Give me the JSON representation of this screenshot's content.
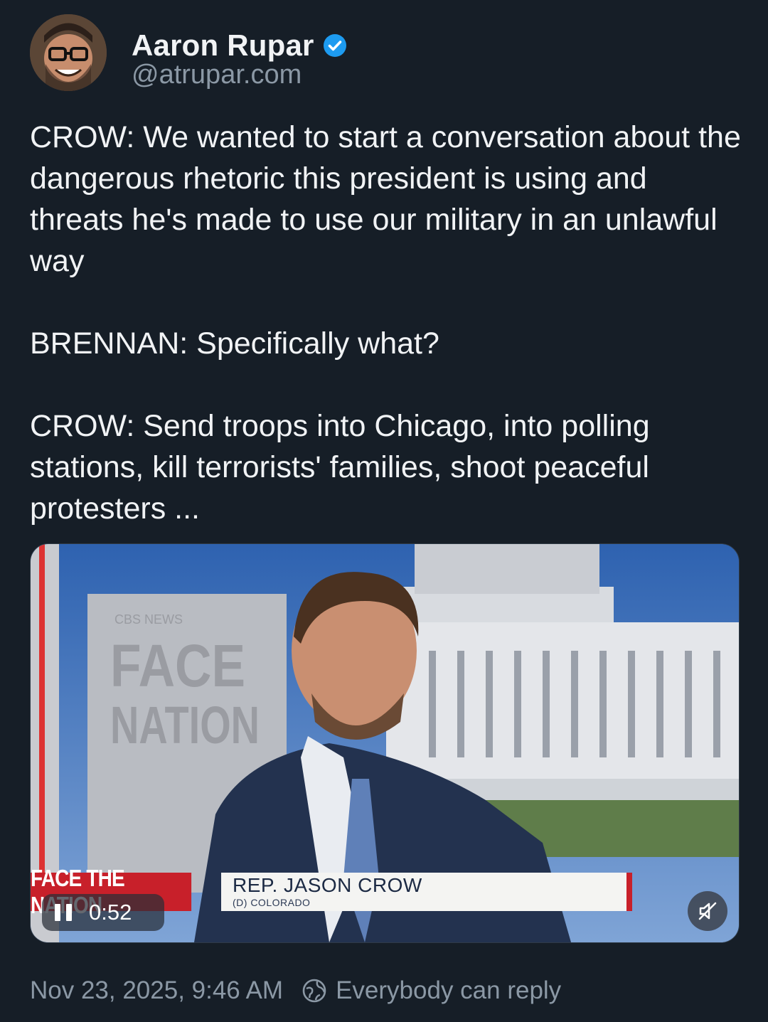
{
  "author": {
    "display_name": "Aaron Rupar",
    "handle": "@atrupar.com",
    "verified": true
  },
  "post": {
    "text": "CROW: We wanted to start a conversation about the dangerous rhetoric this president is using and threats he's made to use our military in an unlawful way\n\nBRENNAN: Specifically what?\n\nCROW: Send troops into Chicago, into polling stations, kill terrorists' families, shoot peaceful protesters ..."
  },
  "video": {
    "backdrop_brand_small": "CBS NEWS",
    "backdrop_brand_face": "FACE",
    "backdrop_brand_nation": "NATION",
    "lower_third_brand": "FACE THE NATION",
    "lower_third_name": "REP. JASON CROW",
    "lower_third_sub": "(D) COLORADO",
    "elapsed": "0:52",
    "state": "playing",
    "muted": true
  },
  "footer": {
    "timestamp": "Nov 23, 2025, 9:46 AM",
    "reply_setting": "Everybody can reply"
  },
  "colors": {
    "background": "#161e27",
    "verified_badge": "#1d9bf0",
    "muted_text": "#8b98a5",
    "accent_red": "#c8202a"
  },
  "icons": [
    "verified-icon",
    "pause-icon",
    "mute-icon",
    "reply-audience-icon"
  ]
}
